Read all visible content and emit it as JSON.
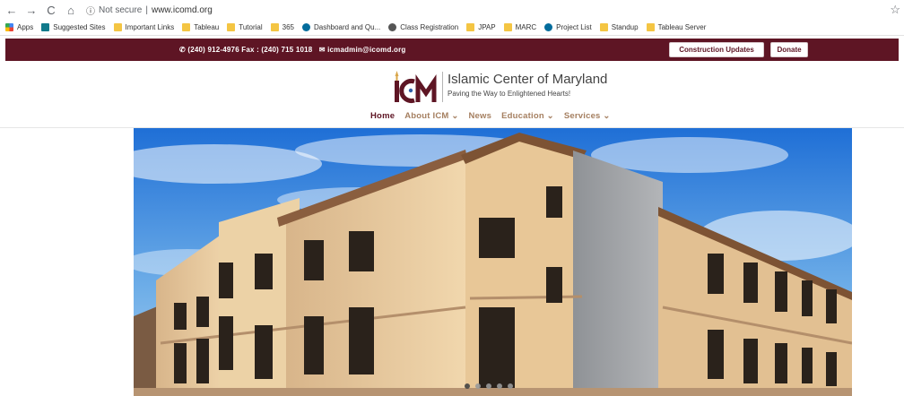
{
  "browser": {
    "back": "←",
    "forward": "→",
    "reload": "C",
    "home": "⌂",
    "info": "ⓘ",
    "security": "Not secure",
    "divider": "|",
    "url": "www.icomd.org",
    "star": "☆"
  },
  "bookmarks": [
    {
      "label": "Apps",
      "icon": "apps-icon"
    },
    {
      "label": "Suggested Sites",
      "icon": "bing-icon"
    },
    {
      "label": "Important Links",
      "icon": "folder-icon"
    },
    {
      "label": "Tableau",
      "icon": "folder-icon"
    },
    {
      "label": "Tutorial",
      "icon": "folder-icon"
    },
    {
      "label": "365",
      "icon": "folder-icon"
    },
    {
      "label": "Dashboard and Qu...",
      "icon": "sharepoint-icon"
    },
    {
      "label": "Class Registration",
      "icon": "globe-icon"
    },
    {
      "label": "JPAP",
      "icon": "folder-icon"
    },
    {
      "label": "MARC",
      "icon": "folder-icon"
    },
    {
      "label": "Project List",
      "icon": "sharepoint-icon"
    },
    {
      "label": "Standup",
      "icon": "folder-icon"
    },
    {
      "label": "Tableau Server",
      "icon": "folder-icon"
    }
  ],
  "topbar": {
    "phone": "(240) 912-4976 Fax : (240) 715 1018",
    "email": "icmadmin@icomd.org",
    "construction_label": "Construction Updates",
    "donate_label": "Donate"
  },
  "logo": {
    "title": "Islamic Center of Maryland",
    "tagline": "Paving the Way to Enlightened Hearts!"
  },
  "nav": {
    "home": "Home",
    "about": "About ICM ⌄",
    "news": "News",
    "education": "Education ⌄",
    "services": "Services ⌄"
  },
  "colors": {
    "brand": "#5e1524",
    "nav_text": "#a57f60"
  }
}
